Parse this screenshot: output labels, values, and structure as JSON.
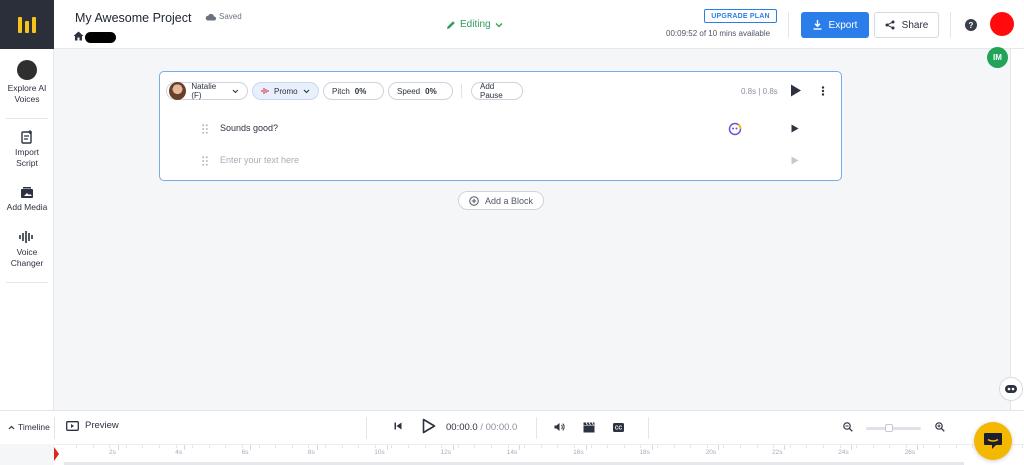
{
  "sidebar": {
    "items": [
      {
        "label": "Explore AI Voices",
        "l1": "Explore AI",
        "l2": "Voices"
      },
      {
        "label": "Import Script",
        "l1": "Import",
        "l2": "Script"
      },
      {
        "label": "Add Media",
        "l1": "Add Media",
        "l2": ""
      },
      {
        "label": "Voice Changer",
        "l1": "Voice",
        "l2": "Changer"
      }
    ]
  },
  "header": {
    "project_title": "My Awesome Project",
    "save_status": "Saved",
    "mode": "Editing",
    "upgrade_label": "UPGRADE PLAN",
    "availability": "00:09:52 of 10 mins available",
    "export_label": "Export",
    "share_label": "Share"
  },
  "badges": {
    "im": "IM"
  },
  "block": {
    "voice": "Natalie (F)",
    "style": "Promo",
    "pitch_label": "Pitch",
    "pitch_value": "0%",
    "speed_label": "Speed",
    "speed_value": "0%",
    "add_pause_label": "Add Pause",
    "duration": "0.8s | 0.8s",
    "lines": [
      {
        "text": "Sounds good?"
      },
      {
        "placeholder": "Enter your text here"
      }
    ]
  },
  "add_block_label": "Add a Block",
  "bottom_bar": {
    "timeline_label": "Timeline",
    "preview_label": "Preview",
    "current_time": "00:00.0",
    "total_time": "/ 00:00.0"
  },
  "ruler": {
    "ticks": [
      "2s",
      "4s",
      "6s",
      "8s",
      "10s",
      "12s",
      "14s",
      "16s",
      "18s",
      "20s",
      "22s",
      "24s",
      "26s"
    ]
  },
  "colors": {
    "accent": "#2b7de9",
    "editing": "#2f9e5a",
    "chat": "#f5b800",
    "logo_bg": "#2b2f3a"
  }
}
